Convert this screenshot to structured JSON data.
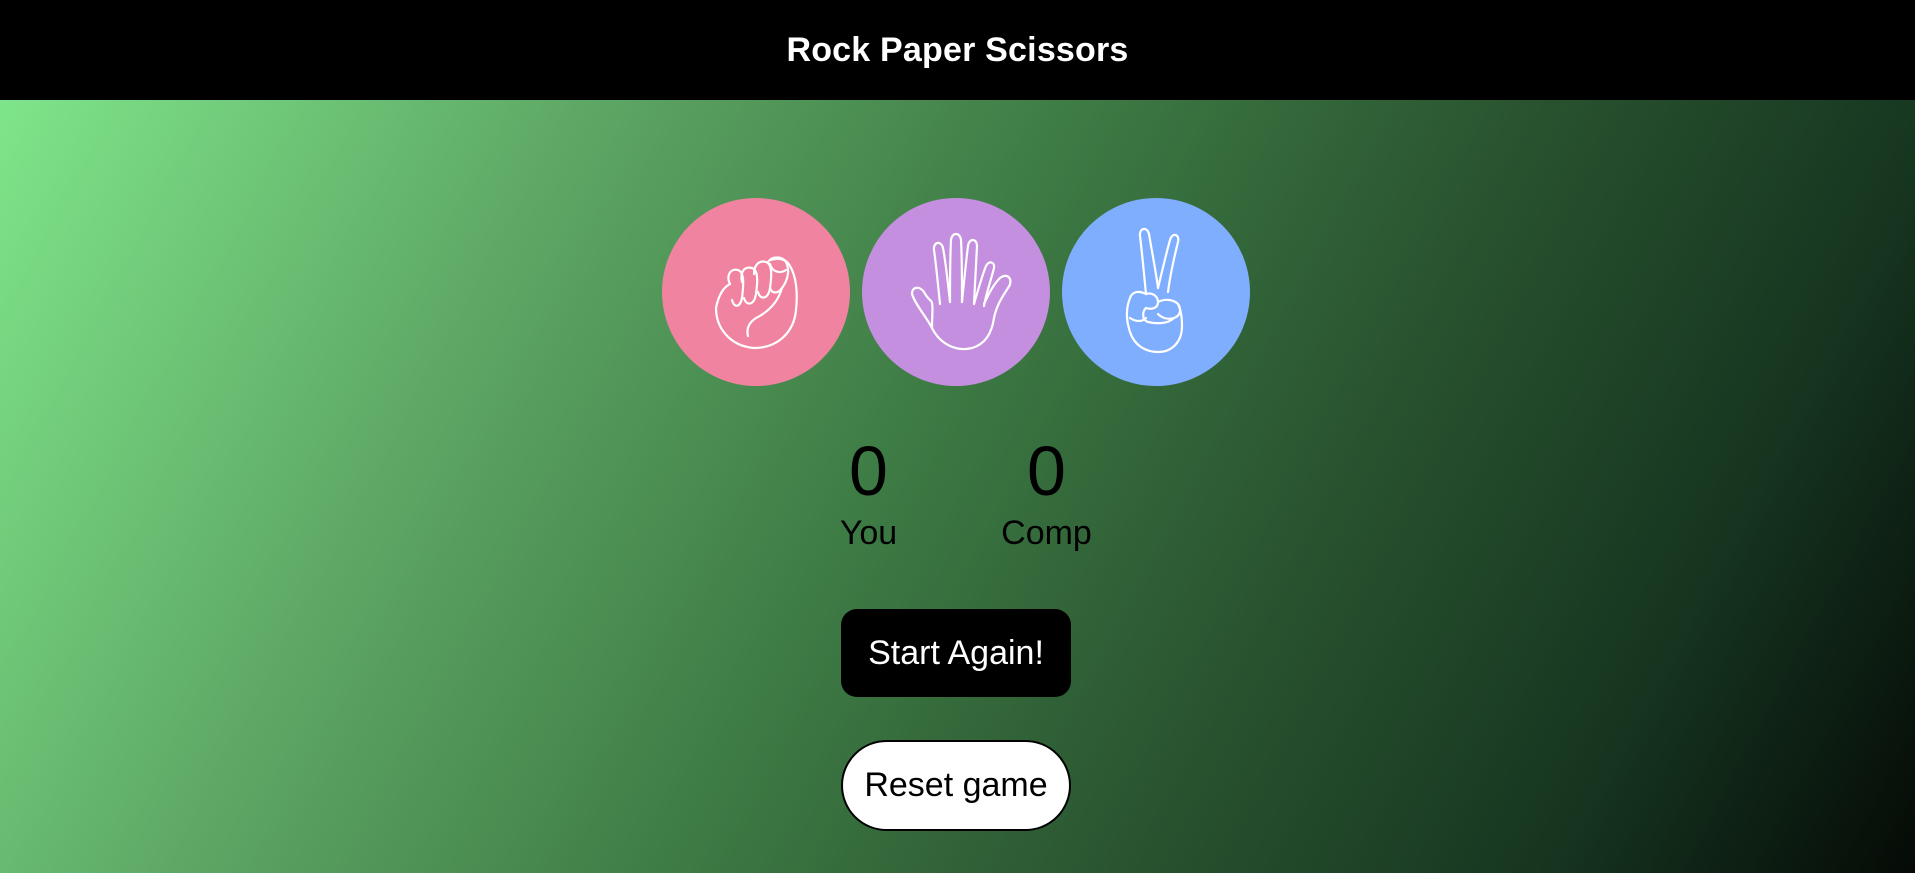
{
  "header": {
    "title": "Rock Paper Scissors"
  },
  "choices": [
    {
      "id": "rock",
      "icon": "fist-icon",
      "color": "#f0839f"
    },
    {
      "id": "paper",
      "icon": "open-hand-icon",
      "color": "#c48fdf"
    },
    {
      "id": "scissors",
      "icon": "peace-hand-icon",
      "color": "#80aefe"
    }
  ],
  "scoreboard": {
    "user": {
      "score": "0",
      "label": "You"
    },
    "computer": {
      "score": "0",
      "label": "Comp"
    }
  },
  "buttons": {
    "start_again": "Start Again!",
    "reset": "Reset game"
  },
  "colors": {
    "header_bg": "#000000",
    "header_text": "#ffffff",
    "gradient_start": "#7fe58a",
    "gradient_end": "#050a06"
  }
}
